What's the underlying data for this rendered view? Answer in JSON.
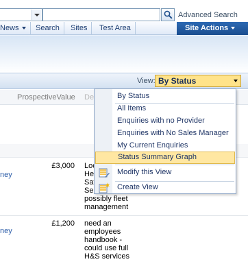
{
  "search": {
    "advanced_label": "Advanced Search"
  },
  "nav": {
    "items": [
      {
        "label": "News"
      },
      {
        "label": "Search"
      },
      {
        "label": "Sites"
      },
      {
        "label": "Test Area"
      }
    ],
    "site_actions": "Site Actions"
  },
  "toolbar": {
    "view_label": "View:",
    "view_selected": "By Status"
  },
  "table": {
    "columns": {
      "prospective_value": "ProspectiveValue",
      "description_partial": "De"
    },
    "rows": [
      {
        "link_fragment": "ney",
        "value": "£3,000",
        "description": [
          "Loo",
          "He",
          "Saf",
          "Ser",
          "possibly fleet",
          "management"
        ]
      },
      {
        "link_fragment": "ney",
        "value": "£1,200",
        "description": [
          "need an",
          "employees",
          "handbook -",
          "could use full",
          "H&S services"
        ]
      }
    ]
  },
  "view_menu": {
    "items": [
      {
        "label": "By Status"
      },
      {
        "label": "All Items"
      },
      {
        "label": "Enquiries with no Provider"
      },
      {
        "label": "Enquiries with No Sales Manager"
      },
      {
        "label": "My Current Enquiries"
      },
      {
        "label": "Status Summary Graph",
        "highlighted": true
      }
    ],
    "actions": [
      {
        "label": "Modify this View",
        "icon": "modify-view-icon"
      },
      {
        "label": "Create View",
        "icon": "create-view-icon"
      }
    ]
  },
  "colors": {
    "site_actions_bg": "#1a4d8f",
    "view_select_bg": "#ffe38a",
    "menu_highlight": "#ffe7a2",
    "link": "#2b5ca8"
  }
}
